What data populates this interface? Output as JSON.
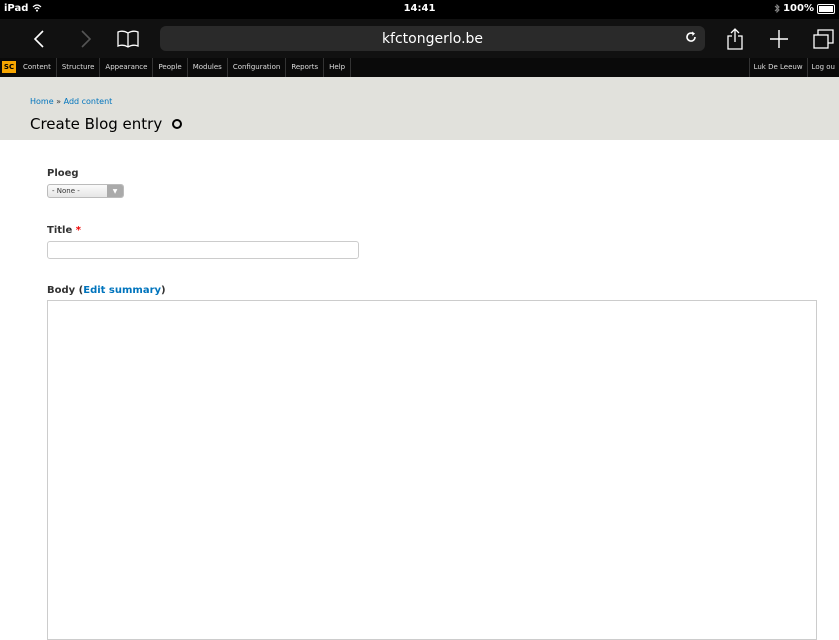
{
  "status": {
    "device": "iPad",
    "time": "14:41",
    "battery": "100%"
  },
  "browser": {
    "url": "kfctongerlo.be"
  },
  "admin": {
    "logo": "SC",
    "menu": [
      "Content",
      "Structure",
      "Appearance",
      "People",
      "Modules",
      "Configuration",
      "Reports",
      "Help"
    ],
    "user": "Luk De Leeuw",
    "logout": "Log ou"
  },
  "header": {
    "breadcrumb_home": "Home",
    "breadcrumb_sep": " » ",
    "breadcrumb_current": "Add content",
    "title": "Create Blog entry"
  },
  "form": {
    "ploeg_label": "Ploeg",
    "ploeg_value": "- None -",
    "title_label": "Title",
    "title_required": "*",
    "body_label": "Body",
    "body_open": " (",
    "edit_summary": "Edit summary",
    "body_close": ")"
  }
}
